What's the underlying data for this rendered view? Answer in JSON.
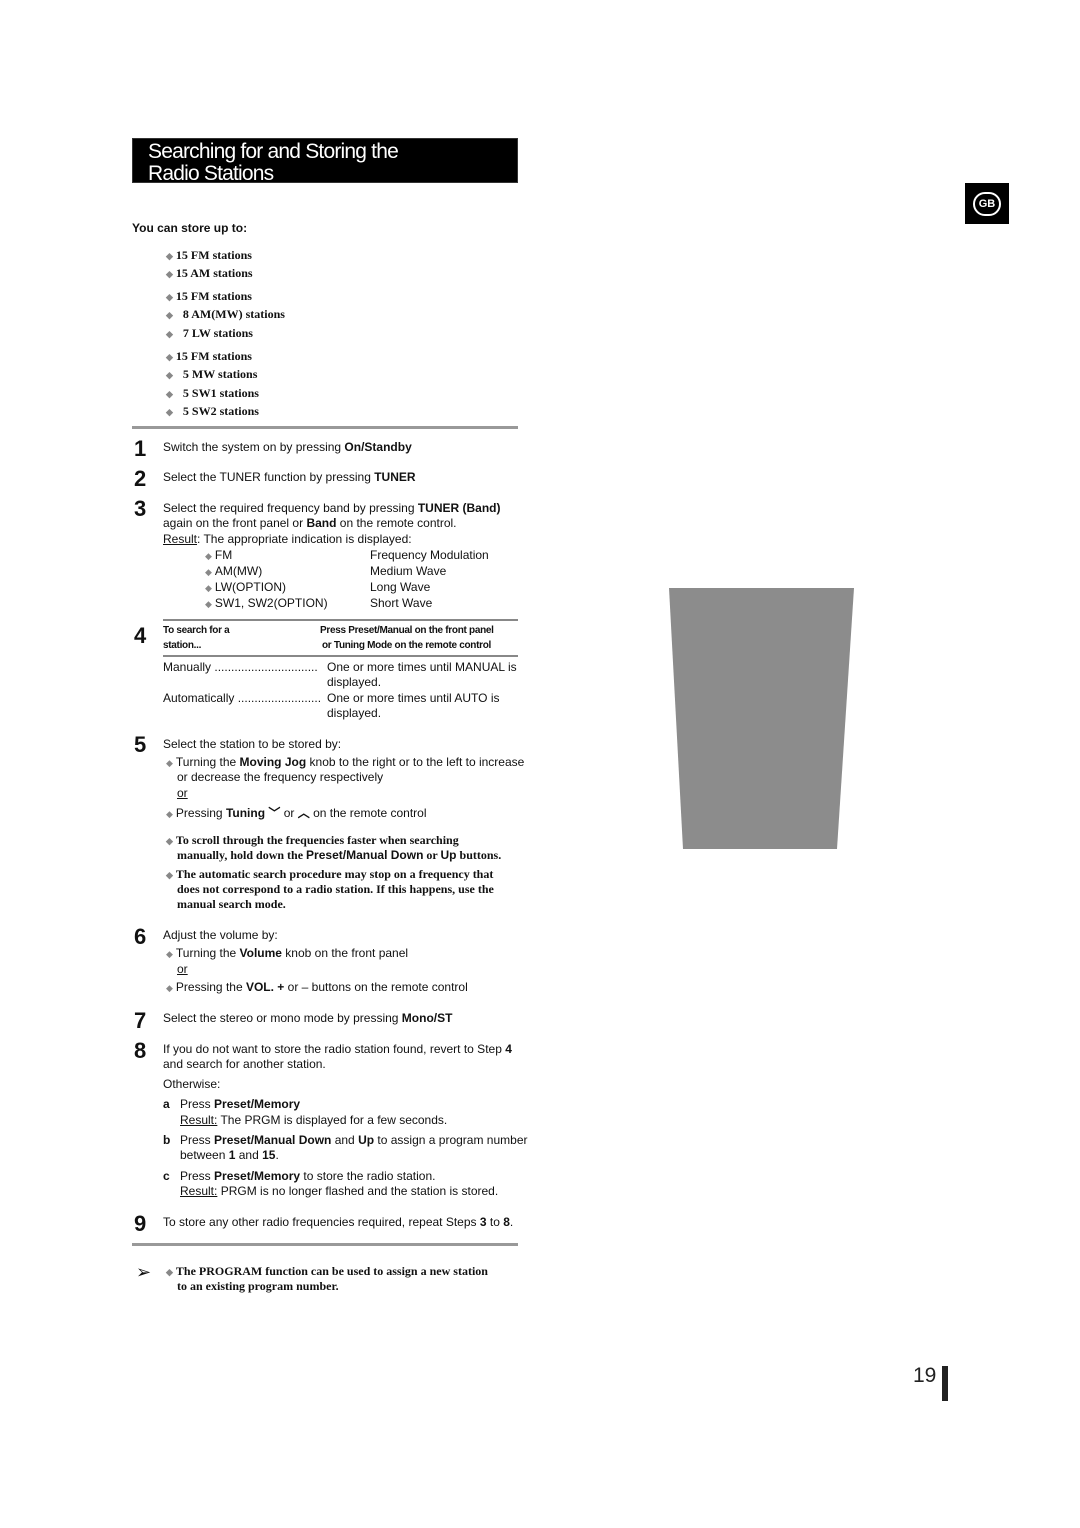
{
  "title": {
    "line1": "Searching for and Storing the",
    "line2": "Radio Stations"
  },
  "badge": "GB",
  "page_number": "19",
  "intro": "You can store up to:",
  "stations": [
    "15 FM stations",
    "15 AM stations",
    "15 FM stations",
    "8 AM(MW) stations",
    "7 LW stations",
    "15 FM stations",
    "5 MW stations",
    "5 SW1 stations",
    "5 SW2 stations"
  ],
  "steps": {
    "s1": {
      "n": "1",
      "t": "Switch the system on by pressing ",
      "b": "On/Standby"
    },
    "s2": {
      "n": "2",
      "t": "Select the TUNER function by pressing ",
      "b": "TUNER"
    },
    "s3": {
      "n": "3",
      "t1": "Select the required frequency band by pressing ",
      "b1": "TUNER (Band)",
      "t2": "again on the front panel or ",
      "b2": "Band",
      "t3": " on the remote control.",
      "result": "Result",
      "result_text": ": The appropriate indication is displayed:",
      "bands": [
        {
          "k": "FM",
          "v": "Frequency Modulation"
        },
        {
          "k": "AM(MW)",
          "v": "Medium Wave"
        },
        {
          "k": "LW(OPTION)",
          "v": "Long Wave"
        },
        {
          "k": "SW1, SW2(OPTION)",
          "v": "Short Wave"
        }
      ]
    },
    "s4": {
      "n": "4",
      "h1a": "To search for a",
      "h1b": "station...",
      "h2a": "Press Preset/Manual on the front panel",
      "h2b": "or Tuning Mode on the remote control",
      "rows": [
        {
          "k": "Manually ...............................",
          "v1": "One or more times until MANUAL   is",
          "v2": "displayed."
        },
        {
          "k": "Automatically .........................",
          "v1": "One or more times until AUTO   is",
          "v2": "displayed."
        }
      ]
    },
    "s5": {
      "n": "5",
      "t": "Select the station to be stored by:",
      "a1": "Turning the ",
      "ab": "Moving Jog",
      "a2": " knob to the right or to the left to increase",
      "a3": "or decrease the frequency respectively",
      "or": "or",
      "p1": "Pressing ",
      "pb": "Tuning",
      "p2": " or ",
      "p3": " on the remote control",
      "n1a": "To scroll through the frequencies faster when searching",
      "n1b": "manually, hold down the ",
      "n1c": "Preset/Manual Down",
      "n1d": "  or ",
      "n1e": "Up",
      "n1f": " buttons.",
      "n2a": "The automatic search procedure may stop on a frequency that",
      "n2b": "does not correspond to a radio station. If this happens, use the",
      "n2c": "manual search mode."
    },
    "s6": {
      "n": "6",
      "t": "Adjust the volume by:",
      "a1": "Turning the ",
      "ab": "Volume",
      "a2": " knob on the front panel",
      "or": "or",
      "p1": "Pressing the ",
      "pb": "VOL. +",
      "p2": " or – buttons on the remote control"
    },
    "s7": {
      "n": "7",
      "t": "Select the stereo or mono mode by pressing ",
      "b": "Mono/ST"
    },
    "s8": {
      "n": "8",
      "t1": "If you do not want to store the radio station found, revert to Step ",
      "b1": "4",
      "t2": "and search for another station.",
      "otherwise": "Otherwise:",
      "a": {
        "l": "a",
        "t": "Press ",
        "b": "Preset/Memory",
        "r": "Result:",
        "rt": " The PRGM  is displayed for a few seconds."
      },
      "b": {
        "l": "b",
        "t": "Press ",
        "b1": "Preset/Manual Down",
        "t2": " and ",
        "b2": "Up",
        "t3": " to assign a program number",
        "t4": "between ",
        "b3": "1",
        "t5": " and ",
        "b4": "15",
        "t6": "."
      },
      "c": {
        "l": "c",
        "t": "Press ",
        "b": "Preset/Memory",
        "t2": " to store the radio station.",
        "r": "Result:",
        "rt": " PRGM  is no longer flashed and the station is stored."
      }
    },
    "s9": {
      "n": "9",
      "t": "To store any other radio frequencies required, repeat Steps ",
      "b1": "3",
      "t2": " to ",
      "b2": "8",
      "t3": "."
    }
  },
  "note": {
    "l1": "The PROGRAM function can be used to assign a new station",
    "l2": "to an existing program number."
  }
}
